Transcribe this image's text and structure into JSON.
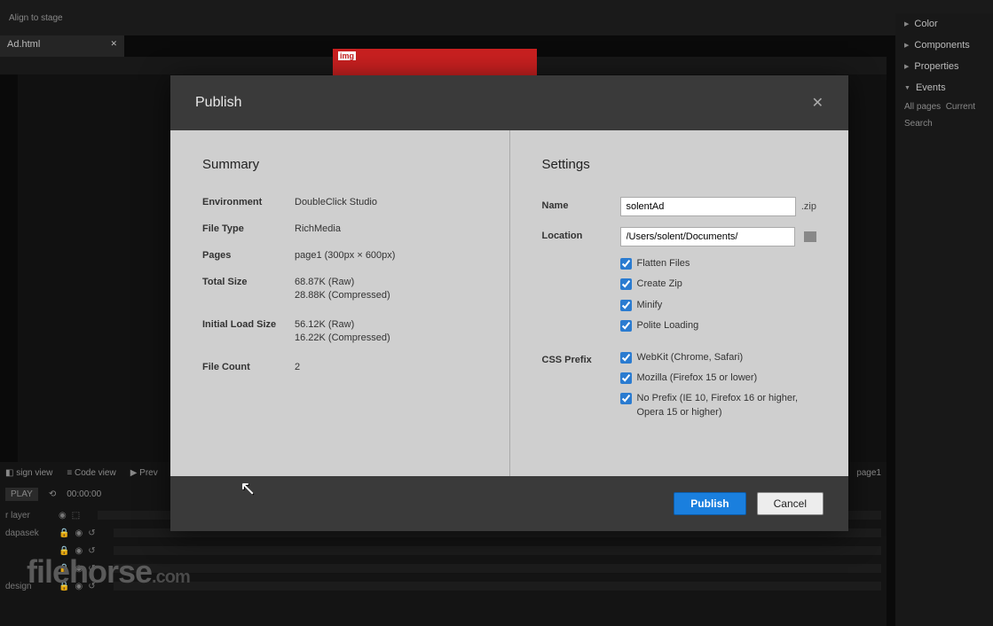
{
  "bg": {
    "tab_name": "Ad.html",
    "red_text": "img",
    "right": {
      "color": "Color",
      "components": "Components",
      "properties": "Properties",
      "events": "Events",
      "all_pages": "All pages",
      "current": "Current",
      "search": "Search"
    },
    "bottom": {
      "design_view": "sign view",
      "code_view": "Code view",
      "preview": "Prev",
      "play": "PLAY",
      "time": "00:00:00",
      "layer": "r layer",
      "page_label": "page1"
    }
  },
  "watermark": {
    "main": "filehorse",
    "suffix": ".com"
  },
  "modal": {
    "title": "Publish",
    "summary_title": "Summary",
    "settings_title": "Settings",
    "summary": {
      "environment_k": "Environment",
      "environment_v": "DoubleClick Studio",
      "filetype_k": "File Type",
      "filetype_v": "RichMedia",
      "pages_k": "Pages",
      "pages_v": "page1 (300px × 600px)",
      "totalsize_k": "Total Size",
      "totalsize_raw": "68.87K (Raw)",
      "totalsize_comp": "28.88K (Compressed)",
      "initial_k": "Initial Load Size",
      "initial_raw": "56.12K (Raw)",
      "initial_comp": "16.22K (Compressed)",
      "filecount_k": "File Count",
      "filecount_v": "2"
    },
    "settings": {
      "name_k": "Name",
      "name_v": "solentAd",
      "name_ext": ".zip",
      "location_k": "Location",
      "location_v": "/Users/solent/Documents/",
      "flatten": "Flatten Files",
      "createzip": "Create Zip",
      "minify": "Minify",
      "polite": "Polite Loading",
      "cssprefix_k": "CSS Prefix",
      "webkit": "WebKit (Chrome, Safari)",
      "mozilla": "Mozilla (Firefox 15 or lower)",
      "noprefix": "No Prefix (IE 10, Firefox 16 or higher, Opera 15 or higher)"
    },
    "buttons": {
      "publish": "Publish",
      "cancel": "Cancel"
    }
  }
}
